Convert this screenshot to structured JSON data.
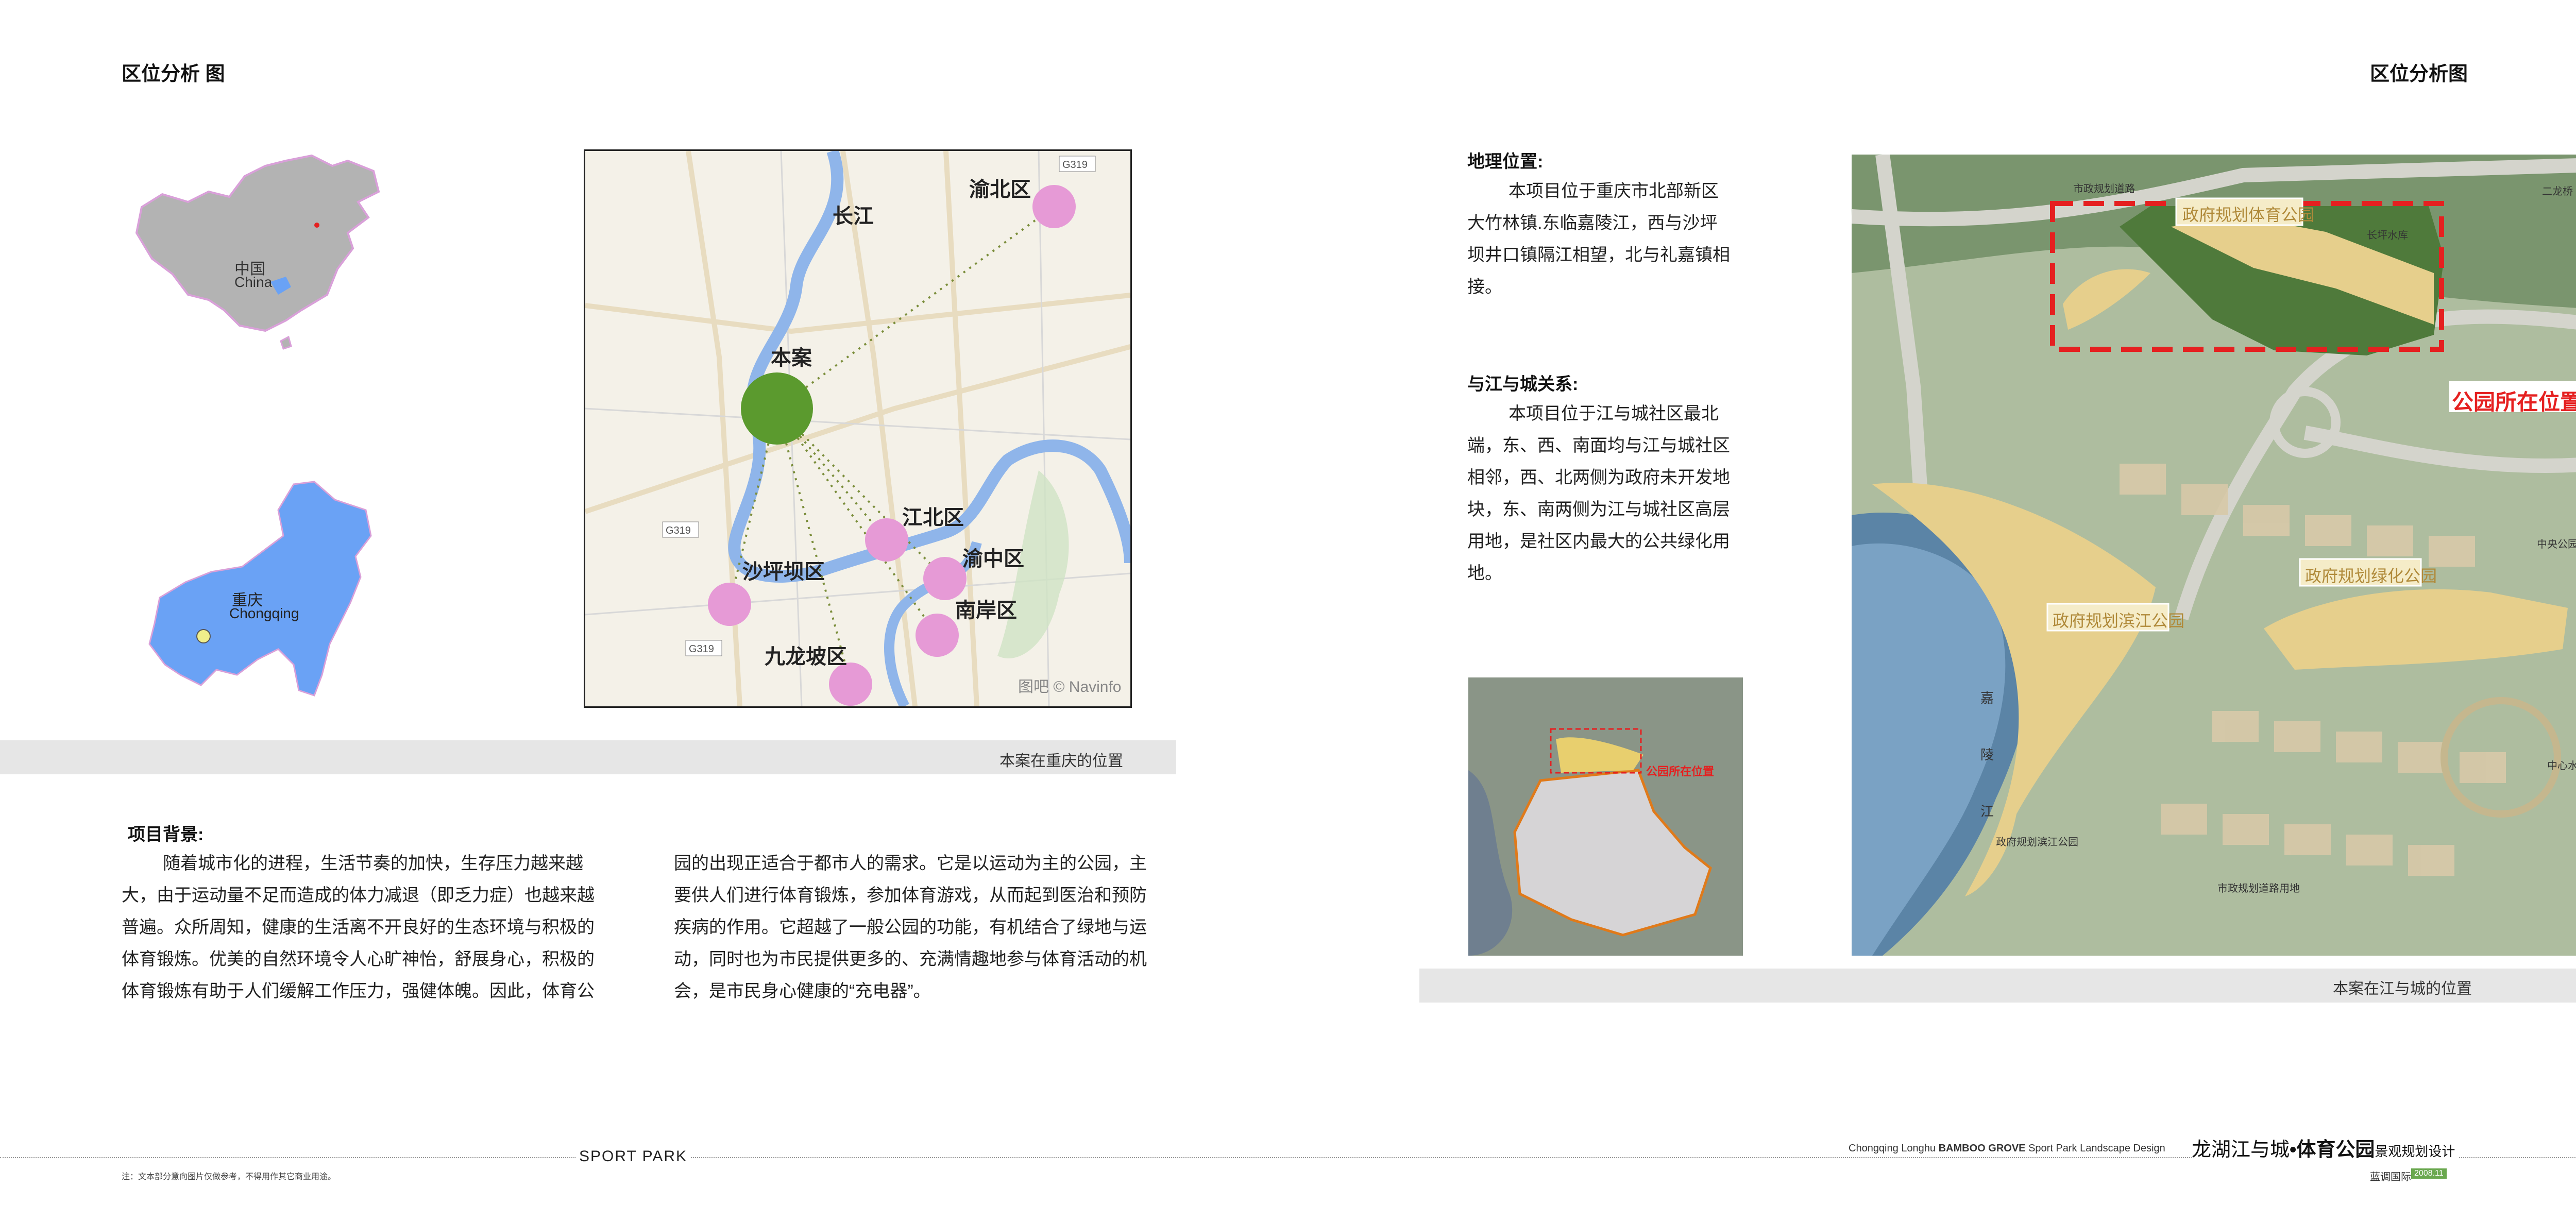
{
  "left_page": {
    "title": "区位分析 图",
    "china_map": {
      "label_cn": "中国",
      "label_en": "China"
    },
    "chongqing_map": {
      "label_cn": "重庆",
      "label_en": "Chongqing"
    },
    "city_map": {
      "labels": {
        "river": "长江",
        "project": "本案",
        "yubei": "渝北区",
        "jiangbei": "江北区",
        "yuzhong": "渝中区",
        "shapingba": "沙坪坝区",
        "nanan": "南岸区",
        "jiulongpo": "九龙坡区"
      },
      "road_labels": [
        "G319",
        "G319",
        "G319"
      ],
      "watermark": "图吧 © Navinfo"
    },
    "caption": "本案在重庆的位置",
    "background": {
      "heading": "项目背景:",
      "col1": [
        "随着城市化的进程，生活节奏的加快，生存压力越来越",
        "大，由于运动量不足而造成的体力减退（即乏力症）也越来越",
        "普遍。众所周知，健康的生活离不开良好的生态环境与积极的",
        "体育锻炼。优美的自然环境令人心旷神怡，舒展身心，积极的",
        "体育锻炼有助于人们缓解工作压力，强健体魄。因此，体育公"
      ],
      "col2": [
        "园的出现正适合于都市人的需求。它是以运动为主的公园，主",
        "要供人们进行体育锻炼，参加体育游戏，从而起到医治和预防",
        "疾病的作用。它超越了一般公园的功能，有机结合了绿地与运",
        "动，同时也为市民提供更多的、充满情趣地参与体育活动的机",
        "会，是市民身心健康的“充电器”。"
      ]
    },
    "footer": {
      "note": "注：文本部分意向图片仅做参考，不得用作其它商业用途。",
      "sport_park": "SPORT PARK"
    }
  },
  "right_page": {
    "title": "区位分析图",
    "geo": {
      "heading": "地理位置:",
      "lines": [
        "本项目位于重庆市北部新区",
        "大竹林镇.东临嘉陵江，西与沙坪",
        "坝井口镇隔江相望，北与礼嘉镇相",
        "接。"
      ]
    },
    "relation": {
      "heading": "与江与城关系:",
      "lines": [
        "本项目位于江与城社区最北",
        "端，东、西、南面均与江与城社区",
        "相邻，西、北两侧为政府未开发地",
        "块，东、南两侧为江与城社区高层",
        "用地，是社区内最大的公共绿化用",
        "地。"
      ]
    },
    "small_map_label": "公园所在位置",
    "aerial": {
      "park_location": "公园所在位置",
      "labels": {
        "top_park": "政府规划体育公园",
        "green_park": "政府规划绿化公园",
        "river_park": "政府规划滨江公园",
        "river_name": "嘉陵江",
        "top_road": "市政规划道路",
        "bottom_road": "市政规划道路用地",
        "water": "长坪水库",
        "bottom_left": "政府规划滨江公园",
        "right_top": "二龙桥",
        "right_mid": "中央公园",
        "right_low": "中心水系"
      }
    },
    "caption": "本案在江与城的位置",
    "footer": {
      "en_prefix": "Chongqing Longhu ",
      "en_bold": "BAMBOO GROVE",
      "en_suffix": " Sport Park Landscape Design",
      "cn_main": "龙湖江与城",
      "cn_dot": "•",
      "cn_bold": "体育公园",
      "cn_sub": "景观规划设计",
      "company": "蓝调国际",
      "badge": "2008.11"
    }
  },
  "colors": {
    "band": "#e6e6e6",
    "river_blue": "#8fb5ea",
    "pink": "#e69ad6",
    "green": "#5b9a2e",
    "chongqing_blue": "#6aa2f5",
    "china_gray": "#b3b3b3",
    "park_yellow": "#e6cf8c",
    "red": "#e52020"
  }
}
